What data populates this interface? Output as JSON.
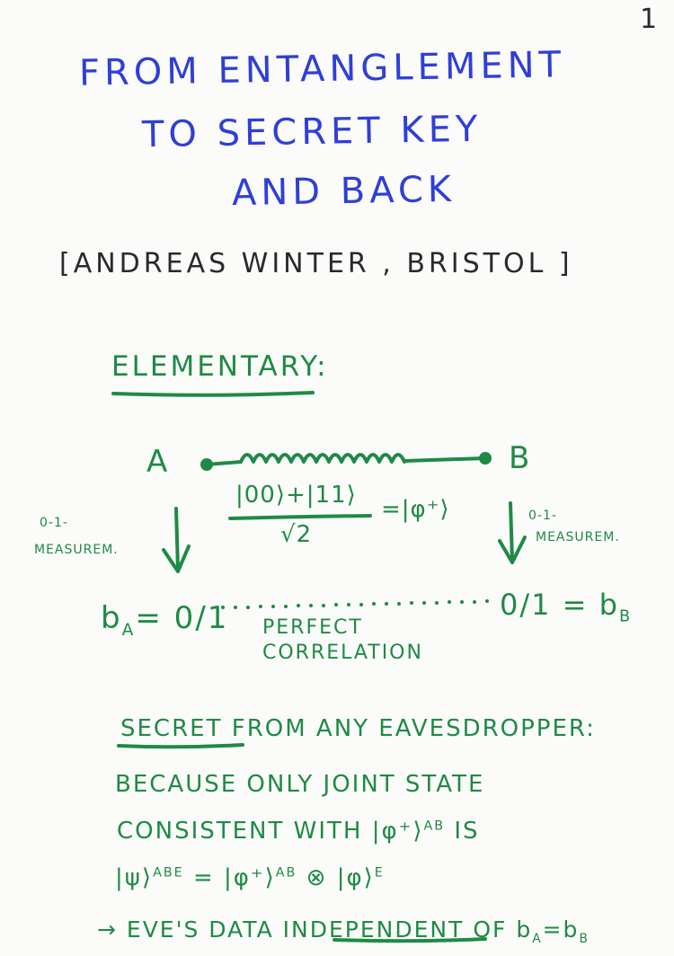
{
  "page_number": "1",
  "title": {
    "line1": "FROM ENTANGLEMENT",
    "line2": "TO SECRET KEY",
    "line3": "AND BACK"
  },
  "author": "[ANDREAS WINTER , BRISTOL ]",
  "section": {
    "heading": "ELEMENTARY:"
  },
  "diagram": {
    "party_a": "A",
    "party_b": "B",
    "state_numerator": "|00⟩+|11⟩",
    "state_denominator": "√2",
    "state_equals": "=|φ⁺⟩",
    "measure_left_1": "0-1-",
    "measure_left_2": "MEASUREM.",
    "measure_right_1": "0-1-",
    "measure_right_2": "MEASUREM.",
    "result_left": "b",
    "result_left_sub": "A",
    "result_left_value": "= 0/1",
    "result_right_value": "0/1 = b",
    "result_right_sub": "B",
    "correlation_1": "PERFECT",
    "correlation_2": "CORRELATION"
  },
  "secret": {
    "secret_word": "SECRET",
    "rest": "FROM ANY EAVESDROPPER:"
  },
  "because": {
    "line1": "BECAUSE ONLY JOINT STATE",
    "line2_a": "CONSISTENT WITH |φ⁺⟩",
    "line2_sup": "AB",
    "line2_b": " IS",
    "line3_a": "|ψ⟩",
    "line3_sup1": "ABE",
    "line3_b": " = |φ⁺⟩",
    "line3_sup2": "AB",
    "line3_c": " ⊗ |φ⟩",
    "line3_sup3": "E"
  },
  "conclusion": {
    "arrow": "→",
    "text_a": "EVE'S DATA",
    "independent": "INDEPENDENT",
    "text_b": "OF b",
    "sub1": "A",
    "eq": "=b",
    "sub2": "B"
  },
  "colors": {
    "title_ink": "#2f3fd6",
    "body_ink": "#1f8a45",
    "author_ink": "#2a2a2a",
    "paper": "#fbfbf9"
  }
}
